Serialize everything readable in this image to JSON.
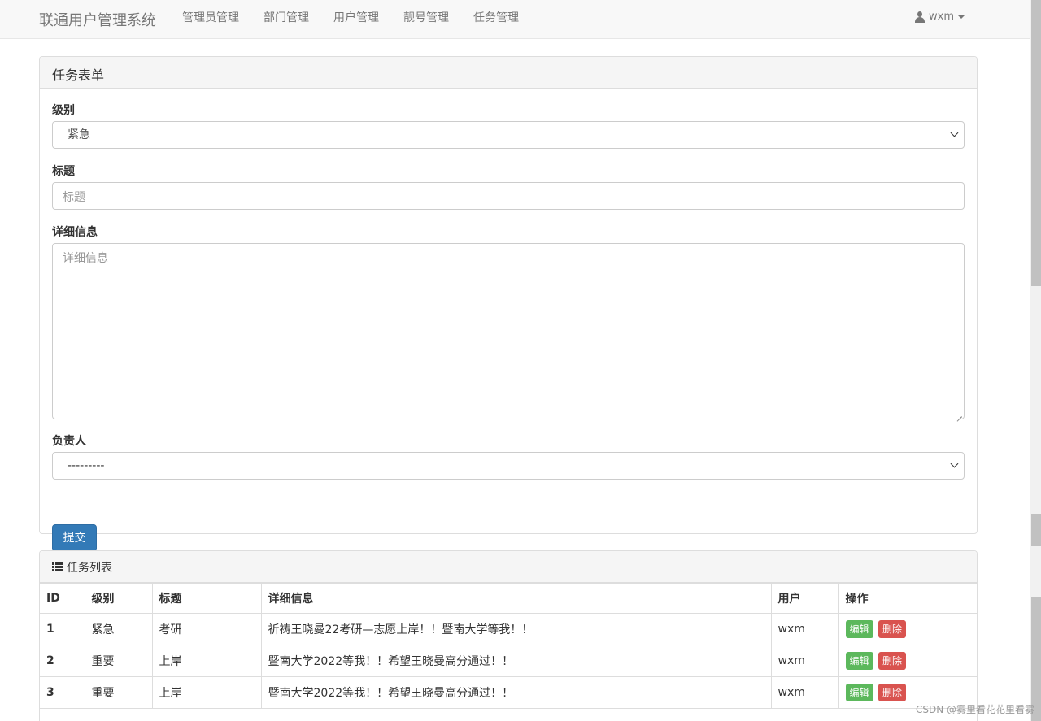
{
  "navbar": {
    "brand": "联通用户管理系统",
    "links": [
      "管理员管理",
      "部门管理",
      "用户管理",
      "靓号管理",
      "任务管理"
    ],
    "user": "wxm"
  },
  "form": {
    "heading": "任务表单",
    "level_label": "级别",
    "level_value": "紧急",
    "title_label": "标题",
    "title_placeholder": "标题",
    "detail_label": "详细信息",
    "detail_placeholder": "详细信息",
    "owner_label": "负责人",
    "owner_value": "---------",
    "submit_label": "提交"
  },
  "list": {
    "heading": "任务列表",
    "columns": [
      "ID",
      "级别",
      "标题",
      "详细信息",
      "用户",
      "操作"
    ],
    "rows": [
      {
        "id": "1",
        "level": "紧急",
        "title": "考研",
        "detail": "祈祷王晓曼22考研—志愿上岸！！暨南大学等我！！",
        "user": "wxm"
      },
      {
        "id": "2",
        "level": "重要",
        "title": "上岸",
        "detail": "暨南大学2022等我！！希望王晓曼高分通过！！",
        "user": "wxm"
      },
      {
        "id": "3",
        "level": "重要",
        "title": "上岸",
        "detail": "暨南大学2022等我！！希望王晓曼高分通过！！",
        "user": "wxm"
      }
    ],
    "edit_label": "编辑",
    "delete_label": "删除"
  },
  "watermark": "CSDN @雾里看花花里看雾"
}
